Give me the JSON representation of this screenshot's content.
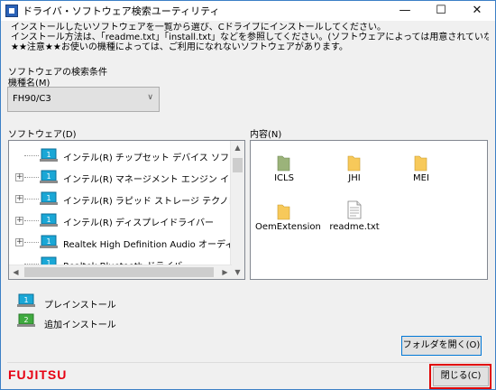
{
  "window": {
    "title": "ドライバ・ソフトウェア検索ユーティリティ",
    "minimize": "—",
    "maximize": "☐",
    "close": "✕"
  },
  "intro": {
    "line1": "インストールしたいソフトウェアを一覧から選び、Cドライブにインストールしてください。",
    "line2": "インストール方法は、「readme.txt」「install.txt」などを参照してください。(ソフトウェアによっては用意されていない場合もあります)",
    "line3": "★★注意★★お使いの機種によっては、ご利用になれないソフトウェアがあります。"
  },
  "criteria": {
    "heading": "ソフトウェアの検索条件",
    "model_label": "機種名(M)",
    "model_value": "FH90/C3"
  },
  "software": {
    "label": "ソフトウェア(D)",
    "items": [
      {
        "label": "インテル(R) チップセット デバイス ソフトウェア",
        "expander": "",
        "icon": "preinstall-icon"
      },
      {
        "label": "インテル(R) マネージメント エンジン インターフェース",
        "expander": "+",
        "icon": "preinstall-icon"
      },
      {
        "label": "インテル(R) ラピッド ストレージ テクノロジー",
        "expander": "+",
        "icon": "preinstall-icon"
      },
      {
        "label": "インテル(R) ディスプレイドライバー",
        "expander": "+",
        "icon": "preinstall-icon"
      },
      {
        "label": "Realtek High Definition Audio オーディオドライバー",
        "expander": "+",
        "icon": "preinstall-icon"
      },
      {
        "label": "Realtek Bluetooth ドライバー",
        "expander": "",
        "icon": "preinstall-icon"
      }
    ]
  },
  "contents": {
    "label": "内容(N)",
    "items": [
      {
        "name": "ICLS",
        "type": "folder",
        "color": "#9bb37a"
      },
      {
        "name": "JHI",
        "type": "folder",
        "color": "#f7c95a"
      },
      {
        "name": "MEI",
        "type": "folder",
        "color": "#f7c95a"
      },
      {
        "name": "OemExtension",
        "type": "folder",
        "color": "#f7c95a"
      },
      {
        "name": "readme.txt",
        "type": "file"
      }
    ]
  },
  "legend": {
    "preinstall": "プレインストール",
    "additional": "追加インストール"
  },
  "buttons": {
    "open_folder": "フォルダを開く(O)",
    "close": "閉じる(C)"
  },
  "brand": {
    "logo": "FUJITSU",
    "color": "#e60012"
  },
  "colors": {
    "highlight": "#e00000",
    "preinstall_icon": "#1aa7d6",
    "additional_icon": "#3faa3f"
  }
}
